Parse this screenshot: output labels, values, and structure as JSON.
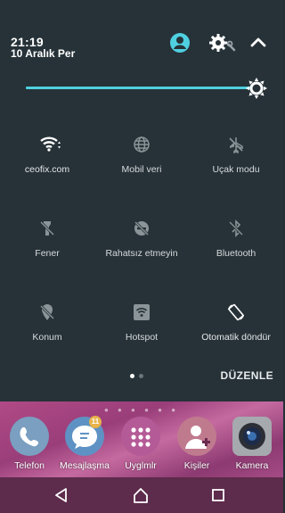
{
  "status": {
    "time": "21:19",
    "date": "10 Aralık Per"
  },
  "header_icons": {
    "avatar": "account-circle-icon",
    "settings": "settings-gear-icon",
    "collapse": "chevron-up-icon"
  },
  "brightness": {
    "level": 0.95,
    "icon": "brightness-icon",
    "accent": "#4fd0e0"
  },
  "tiles": [
    {
      "label": "ceofix.com",
      "icon": "wifi-icon",
      "state": "on"
    },
    {
      "label": "Mobil veri",
      "icon": "globe-icon",
      "state": "off"
    },
    {
      "label": "Uçak modu",
      "icon": "airplane-off-icon",
      "state": "off"
    },
    {
      "label": "Fener",
      "icon": "flashlight-off-icon",
      "state": "off"
    },
    {
      "label": "Rahatsız etmeyin",
      "icon": "do-not-disturb-off-icon",
      "state": "off"
    },
    {
      "label": "Bluetooth",
      "icon": "bluetooth-off-icon",
      "state": "off"
    },
    {
      "label": "Konum",
      "icon": "location-off-icon",
      "state": "off"
    },
    {
      "label": "Hotspot",
      "icon": "hotspot-icon",
      "state": "off"
    },
    {
      "label": "Otomatik döndür",
      "icon": "auto-rotate-icon",
      "state": "on"
    }
  ],
  "edit_label": "DÜZENLE",
  "dock": {
    "apps": [
      {
        "label": "Telefon",
        "icon": "phone-app-icon"
      },
      {
        "label": "Mesajlaşma",
        "icon": "messaging-app-icon",
        "badge": "11"
      },
      {
        "label": "Uyglmlr",
        "icon": "app-drawer-icon"
      },
      {
        "label": "Kişiler",
        "icon": "contacts-app-icon"
      },
      {
        "label": "Kamera",
        "icon": "camera-app-icon"
      }
    ]
  },
  "colors": {
    "panel": "#263238",
    "accent": "#4fd0e0",
    "wallpaper": "#b04a86",
    "navbar": "#5d2b4c"
  }
}
